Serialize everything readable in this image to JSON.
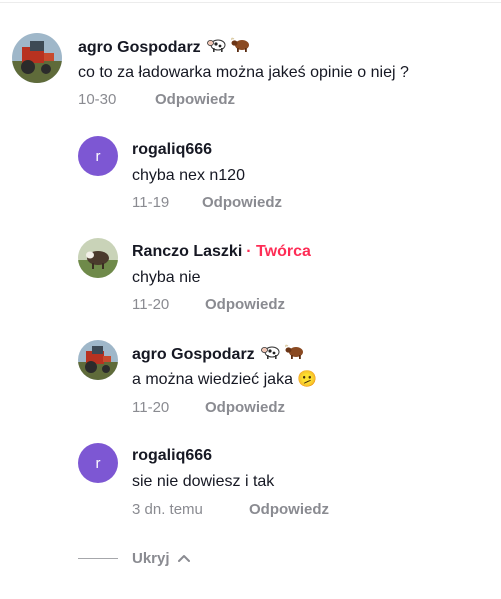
{
  "comments": [
    {
      "author": "agro Gospodarz",
      "text": "co to za ładowarka można jakeś opinie o niej ?",
      "date": "10-30",
      "reply_label": "Odpowiedz"
    },
    {
      "author": "rogaliq666",
      "avatar_letter": "r",
      "text": "chyba nex n120",
      "date": "11-19",
      "reply_label": "Odpowiedz"
    },
    {
      "author": "Ranczo Laszki",
      "creator_badge": "· Twórca",
      "text": "chyba nie",
      "date": "11-20",
      "reply_label": "Odpowiedz"
    },
    {
      "author": "agro Gospodarz",
      "text": "a można wiedzieć jaka 🫤",
      "date": "11-20",
      "reply_label": "Odpowiedz"
    },
    {
      "author": "rogaliq666",
      "avatar_letter": "r",
      "text": "sie nie dowiesz i tak",
      "date": "3 dn. temu",
      "reply_label": "Odpowiedz"
    }
  ],
  "hide_label": "Ukryj",
  "colors": {
    "creator": "#fe2c55",
    "avatar_purple": "#7d57d3",
    "muted_text": "#8a8b91"
  },
  "icons": {
    "cow1": "cow-icon",
    "cow2": "ox-icon",
    "chevron": "chevron-up-icon"
  }
}
